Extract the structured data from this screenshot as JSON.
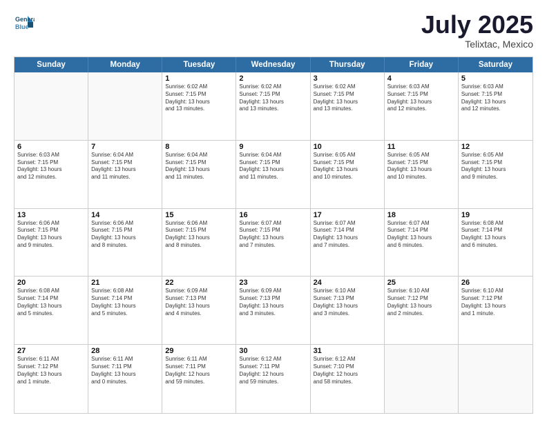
{
  "header": {
    "logo_line1": "General",
    "logo_line2": "Blue",
    "title": "July 2025",
    "location": "Telixtac, Mexico"
  },
  "days_of_week": [
    "Sunday",
    "Monday",
    "Tuesday",
    "Wednesday",
    "Thursday",
    "Friday",
    "Saturday"
  ],
  "weeks": [
    [
      {
        "num": "",
        "text": "",
        "empty": true
      },
      {
        "num": "",
        "text": "",
        "empty": true
      },
      {
        "num": "1",
        "text": "Sunrise: 6:02 AM\nSunset: 7:15 PM\nDaylight: 13 hours\nand 13 minutes."
      },
      {
        "num": "2",
        "text": "Sunrise: 6:02 AM\nSunset: 7:15 PM\nDaylight: 13 hours\nand 13 minutes."
      },
      {
        "num": "3",
        "text": "Sunrise: 6:02 AM\nSunset: 7:15 PM\nDaylight: 13 hours\nand 13 minutes."
      },
      {
        "num": "4",
        "text": "Sunrise: 6:03 AM\nSunset: 7:15 PM\nDaylight: 13 hours\nand 12 minutes."
      },
      {
        "num": "5",
        "text": "Sunrise: 6:03 AM\nSunset: 7:15 PM\nDaylight: 13 hours\nand 12 minutes."
      }
    ],
    [
      {
        "num": "6",
        "text": "Sunrise: 6:03 AM\nSunset: 7:15 PM\nDaylight: 13 hours\nand 12 minutes."
      },
      {
        "num": "7",
        "text": "Sunrise: 6:04 AM\nSunset: 7:15 PM\nDaylight: 13 hours\nand 11 minutes."
      },
      {
        "num": "8",
        "text": "Sunrise: 6:04 AM\nSunset: 7:15 PM\nDaylight: 13 hours\nand 11 minutes."
      },
      {
        "num": "9",
        "text": "Sunrise: 6:04 AM\nSunset: 7:15 PM\nDaylight: 13 hours\nand 11 minutes."
      },
      {
        "num": "10",
        "text": "Sunrise: 6:05 AM\nSunset: 7:15 PM\nDaylight: 13 hours\nand 10 minutes."
      },
      {
        "num": "11",
        "text": "Sunrise: 6:05 AM\nSunset: 7:15 PM\nDaylight: 13 hours\nand 10 minutes."
      },
      {
        "num": "12",
        "text": "Sunrise: 6:05 AM\nSunset: 7:15 PM\nDaylight: 13 hours\nand 9 minutes."
      }
    ],
    [
      {
        "num": "13",
        "text": "Sunrise: 6:06 AM\nSunset: 7:15 PM\nDaylight: 13 hours\nand 9 minutes."
      },
      {
        "num": "14",
        "text": "Sunrise: 6:06 AM\nSunset: 7:15 PM\nDaylight: 13 hours\nand 8 minutes."
      },
      {
        "num": "15",
        "text": "Sunrise: 6:06 AM\nSunset: 7:15 PM\nDaylight: 13 hours\nand 8 minutes."
      },
      {
        "num": "16",
        "text": "Sunrise: 6:07 AM\nSunset: 7:15 PM\nDaylight: 13 hours\nand 7 minutes."
      },
      {
        "num": "17",
        "text": "Sunrise: 6:07 AM\nSunset: 7:14 PM\nDaylight: 13 hours\nand 7 minutes."
      },
      {
        "num": "18",
        "text": "Sunrise: 6:07 AM\nSunset: 7:14 PM\nDaylight: 13 hours\nand 6 minutes."
      },
      {
        "num": "19",
        "text": "Sunrise: 6:08 AM\nSunset: 7:14 PM\nDaylight: 13 hours\nand 6 minutes."
      }
    ],
    [
      {
        "num": "20",
        "text": "Sunrise: 6:08 AM\nSunset: 7:14 PM\nDaylight: 13 hours\nand 5 minutes."
      },
      {
        "num": "21",
        "text": "Sunrise: 6:08 AM\nSunset: 7:14 PM\nDaylight: 13 hours\nand 5 minutes."
      },
      {
        "num": "22",
        "text": "Sunrise: 6:09 AM\nSunset: 7:13 PM\nDaylight: 13 hours\nand 4 minutes."
      },
      {
        "num": "23",
        "text": "Sunrise: 6:09 AM\nSunset: 7:13 PM\nDaylight: 13 hours\nand 3 minutes."
      },
      {
        "num": "24",
        "text": "Sunrise: 6:10 AM\nSunset: 7:13 PM\nDaylight: 13 hours\nand 3 minutes."
      },
      {
        "num": "25",
        "text": "Sunrise: 6:10 AM\nSunset: 7:12 PM\nDaylight: 13 hours\nand 2 minutes."
      },
      {
        "num": "26",
        "text": "Sunrise: 6:10 AM\nSunset: 7:12 PM\nDaylight: 13 hours\nand 1 minute."
      }
    ],
    [
      {
        "num": "27",
        "text": "Sunrise: 6:11 AM\nSunset: 7:12 PM\nDaylight: 13 hours\nand 1 minute."
      },
      {
        "num": "28",
        "text": "Sunrise: 6:11 AM\nSunset: 7:11 PM\nDaylight: 13 hours\nand 0 minutes."
      },
      {
        "num": "29",
        "text": "Sunrise: 6:11 AM\nSunset: 7:11 PM\nDaylight: 12 hours\nand 59 minutes."
      },
      {
        "num": "30",
        "text": "Sunrise: 6:12 AM\nSunset: 7:11 PM\nDaylight: 12 hours\nand 59 minutes."
      },
      {
        "num": "31",
        "text": "Sunrise: 6:12 AM\nSunset: 7:10 PM\nDaylight: 12 hours\nand 58 minutes."
      },
      {
        "num": "",
        "text": "",
        "empty": true
      },
      {
        "num": "",
        "text": "",
        "empty": true
      }
    ]
  ]
}
